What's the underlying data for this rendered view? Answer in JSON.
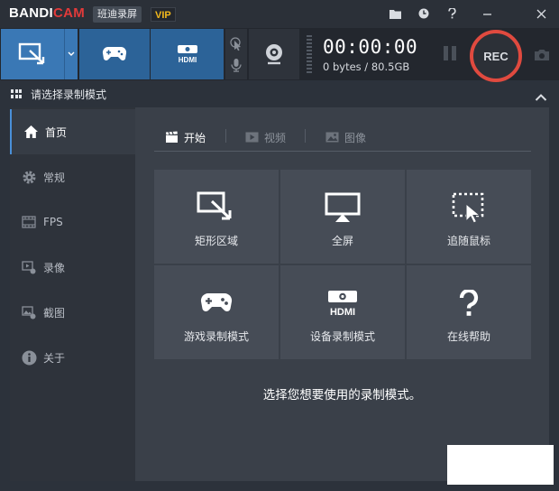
{
  "app": {
    "logo_main": "BANDI",
    "logo_accent": "CAM",
    "subtitle": "班迪录屏",
    "vip": "VIP"
  },
  "window_icons": [
    "folder-icon",
    "clock-icon",
    "help-icon",
    "minimize-icon",
    "close-icon"
  ],
  "toolbar": {
    "modes": [
      "rectangle-area-mode",
      "game-mode",
      "hdmi-device-mode"
    ],
    "timer": "00:00:00",
    "file_size": "0 bytes / 80.5GB",
    "rec_label": "REC"
  },
  "section": {
    "title": "请选择录制模式"
  },
  "sidebar": {
    "items": [
      {
        "label": "首页",
        "icon": "home-icon"
      },
      {
        "label": "常规",
        "icon": "gear-icon"
      },
      {
        "label": "FPS",
        "icon": "fps-icon"
      },
      {
        "label": "录像",
        "icon": "video-icon"
      },
      {
        "label": "截图",
        "icon": "image-icon"
      },
      {
        "label": "关于",
        "icon": "info-icon"
      }
    ]
  },
  "tabs": [
    {
      "label": "开始",
      "icon": "clapperboard-icon"
    },
    {
      "label": "视频",
      "icon": "play-icon"
    },
    {
      "label": "图像",
      "icon": "picture-icon"
    }
  ],
  "tiles": [
    {
      "label": "矩形区域",
      "icon": "rectangle-select-icon"
    },
    {
      "label": "全屏",
      "icon": "monitor-icon"
    },
    {
      "label": "追随鼠标",
      "icon": "follow-cursor-icon"
    },
    {
      "label": "游戏录制模式",
      "icon": "gamepad-icon"
    },
    {
      "label": "设备录制模式",
      "icon": "hdmi-icon"
    },
    {
      "label": "在线帮助",
      "icon": "question-icon"
    }
  ],
  "hint": "选择您想要使用的录制模式。",
  "colors": {
    "accent_blue": "#3a78b5",
    "rec_red": "#e04a3f",
    "logo_red": "#e23a3a",
    "vip_gold": "#f2b81c"
  }
}
